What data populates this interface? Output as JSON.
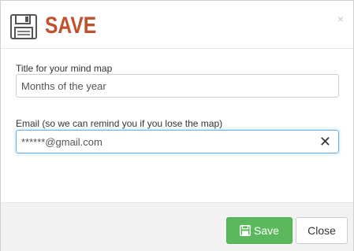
{
  "dialog": {
    "title": "SAVE",
    "close_glyph": "×",
    "title_icon": "floppy-disk-icon"
  },
  "form": {
    "title_label": "Title for your mind map",
    "title_value": "Months of the year",
    "email_label": "Email (so we can remind you if you lose the map)",
    "email_value": "******@gmail.com",
    "clear_glyph": "✕"
  },
  "footer": {
    "save_label": "Save",
    "close_label": "Close"
  },
  "colors": {
    "title": "#c1502e",
    "save_button": "#5cb85c",
    "focus_border": "#66afe9",
    "footer_bg": "#f2f2f2"
  }
}
